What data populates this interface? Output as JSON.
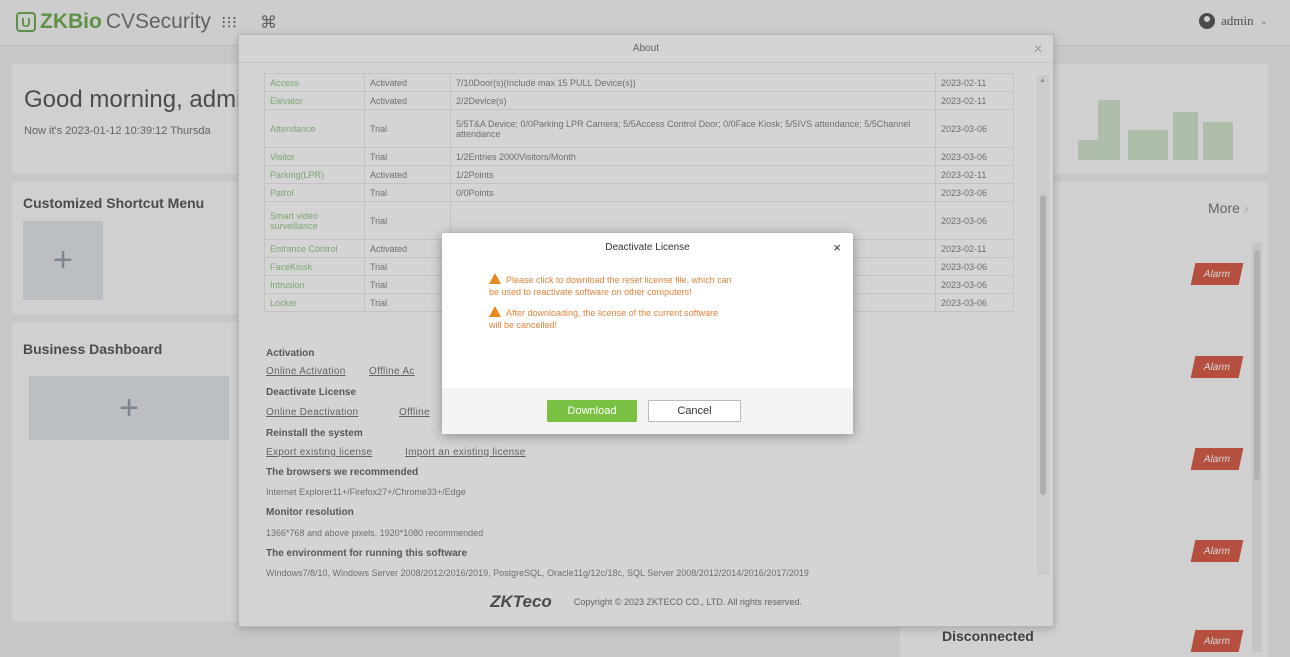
{
  "header": {
    "logo_mark": "U",
    "brand_zk": "ZKBio",
    "brand_rest": " CVSecurity",
    "apps_icon": "⁝⁝⁝",
    "cmd_icon": "⌘",
    "user": "admin"
  },
  "home": {
    "greeting": "Good morning, admin",
    "now_text": "Now it's 2023-01-12 10:39:12 Thursda",
    "shortcut_title": "Customized Shortcut Menu",
    "dashboard_title": "Business Dashboard",
    "more": "More",
    "alarm_label": "Alarm",
    "disconnected": "Disconnected"
  },
  "about": {
    "title": "About",
    "licenses": [
      {
        "module": "Access",
        "status": "Activated",
        "detail": "7/10Door(s)(Include max 15 PULL Device(s))",
        "date": "2023-02-11"
      },
      {
        "module": "Elevator",
        "status": "Activated",
        "detail": "2/2Device(s)",
        "date": "2023-02-11"
      },
      {
        "module": "Attendance",
        "status": "Trial",
        "detail": "5/5T&A Device; 0/0Parking LPR Camera; 5/5Access Control Door; 0/0Face Kiosk; 5/5IVS attendance; 5/5Channel attendance",
        "date": "2023-03-06"
      },
      {
        "module": "Visitor",
        "status": "Trial",
        "detail": "1/2Entries 2000Visitors/Month",
        "date": "2023-03-06"
      },
      {
        "module": "Parking(LPR)",
        "status": "Activated",
        "detail": "1/2Points",
        "date": "2023-02-11"
      },
      {
        "module": "Patrol",
        "status": "Trial",
        "detail": "0/0Points",
        "date": "2023-03-06"
      },
      {
        "module": "Smart video surveillance",
        "status": "Trial",
        "detail": "",
        "date": "2023-03-06"
      },
      {
        "module": "Entrance Control",
        "status": "Activated",
        "detail": "",
        "date": "2023-02-11"
      },
      {
        "module": "FaceKiosk",
        "status": "Trial",
        "detail": "",
        "date": "2023-03-06"
      },
      {
        "module": "Intrusion",
        "status": "Trial",
        "detail": "",
        "date": "2023-03-06"
      },
      {
        "module": "Locker",
        "status": "Trial",
        "detail": "",
        "date": "2023-03-06"
      }
    ],
    "activation_h": "Activation",
    "online_activation": "Online Activation",
    "offline_activation": "Offline Ac",
    "deactivate_h": "Deactivate License",
    "online_deactivation": "Online Deactivation",
    "offline_deactivation": "Offline",
    "reinstall_h": "Reinstall the system",
    "export_license": "Export existing license",
    "import_license": "Import an existing license",
    "browsers_h": "The browsers we recommended",
    "browsers_t": "Internet Explorer11+/Firefox27+/Chrome33+/Edge",
    "monitor_h": "Monitor resolution",
    "monitor_t": "1366*768 and above pixels, 1920*1080 recommended",
    "env_h": "The environment for running this software",
    "env_t": "Windows7/8/10, Windows Server 2008/2012/2016/2019, PostgreSQL, Oracle11g/12c/18c, SQL Server 2008/2012/2014/2016/2017/2019",
    "footer_logo": "ZKTeco",
    "copyright": "Copyright © 2023 ZKTECO CO., LTD. All rights reserved."
  },
  "modal": {
    "title": "Deactivate License",
    "close": "×",
    "warn1_a": "Please click to download the reset license file, which can",
    "warn1_b": "be used to reactivate software on other computers!",
    "warn2_a": "After downloading, the license of the current software",
    "warn2_b": "will be cancelled!",
    "download": "Download",
    "cancel": "Cancel",
    "warn_color": "#e2833d",
    "download_color": "#7ac143"
  }
}
